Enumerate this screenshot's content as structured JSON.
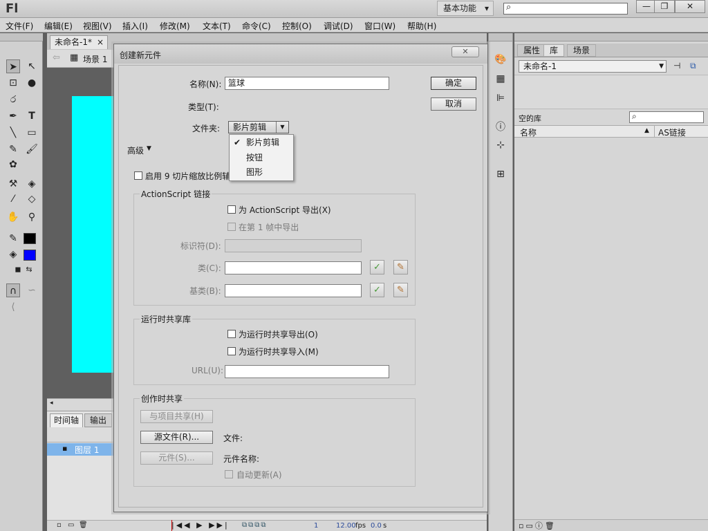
{
  "app": {
    "logo": "Fl",
    "workspace": "基本功能",
    "workspace_arrow": "▾",
    "search_icon": "⌕",
    "win_min": "—",
    "win_max": "❐",
    "win_close": "✕"
  },
  "menubar": [
    "文件(F)",
    "编辑(E)",
    "视图(V)",
    "插入(I)",
    "修改(M)",
    "文本(T)",
    "命令(C)",
    "控制(O)",
    "调试(D)",
    "窗口(W)",
    "帮助(H)"
  ],
  "document": {
    "tab_label": "未命名-1*",
    "tab_close": "×",
    "scene_label": "场景 1",
    "stage_fill": "#00ffff"
  },
  "timeline": {
    "tab_timeline": "时间轴",
    "tab_output": "输出",
    "layer_name": "图层 1",
    "frame": "1",
    "fps": "12.00",
    "fps_unit": "fps",
    "time": "0.0",
    "time_unit": "s"
  },
  "library": {
    "tabs": [
      "属性",
      "库",
      "场景"
    ],
    "doc_select": "未命名-1",
    "empty_label": "空的库",
    "col_name": "名称",
    "col_linkage": "AS链接"
  },
  "dialog": {
    "title": "创建新元件",
    "name_label": "名称(N):",
    "name_value": "篮球",
    "type_label": "类型(T):",
    "type_value": "影片剪辑",
    "folder_label": "文件夹:",
    "ok": "确定",
    "cancel": "取消",
    "advanced": "高级",
    "type_options": [
      {
        "label": "影片剪辑",
        "checked": true
      },
      {
        "label": "按钮",
        "checked": false
      },
      {
        "label": "图形",
        "checked": false
      }
    ],
    "enable_9slice": "启用 9 切片缩放比例辅助线(G)",
    "as_linkage": {
      "title": "ActionScript 链接",
      "export_for_as": "为 ActionScript 导出(X)",
      "export_in_frame1": "在第 1 帧中导出",
      "identifier_label": "标识符(D):",
      "class_label": "类(C):",
      "base_class_label": "基类(B):"
    },
    "runtime_sharing": {
      "title": "运行时共享库",
      "export_for_runtime": "为运行时共享导出(O)",
      "import_for_runtime": "为运行时共享导入(M)",
      "url_label": "URL(U):"
    },
    "authoring_sharing": {
      "title": "创作时共享",
      "share_with_project": "与项目共享(H)",
      "source_file_btn": "源文件(R)...",
      "file_label": "文件:",
      "symbol_btn": "元件(S)...",
      "symbol_name_label": "元件名称:",
      "auto_update": "自动更新(A)"
    }
  },
  "colors": {
    "stroke_color": "#000000",
    "fill_color": "#0000ff",
    "layer_highlight": "#7eb4ea"
  }
}
